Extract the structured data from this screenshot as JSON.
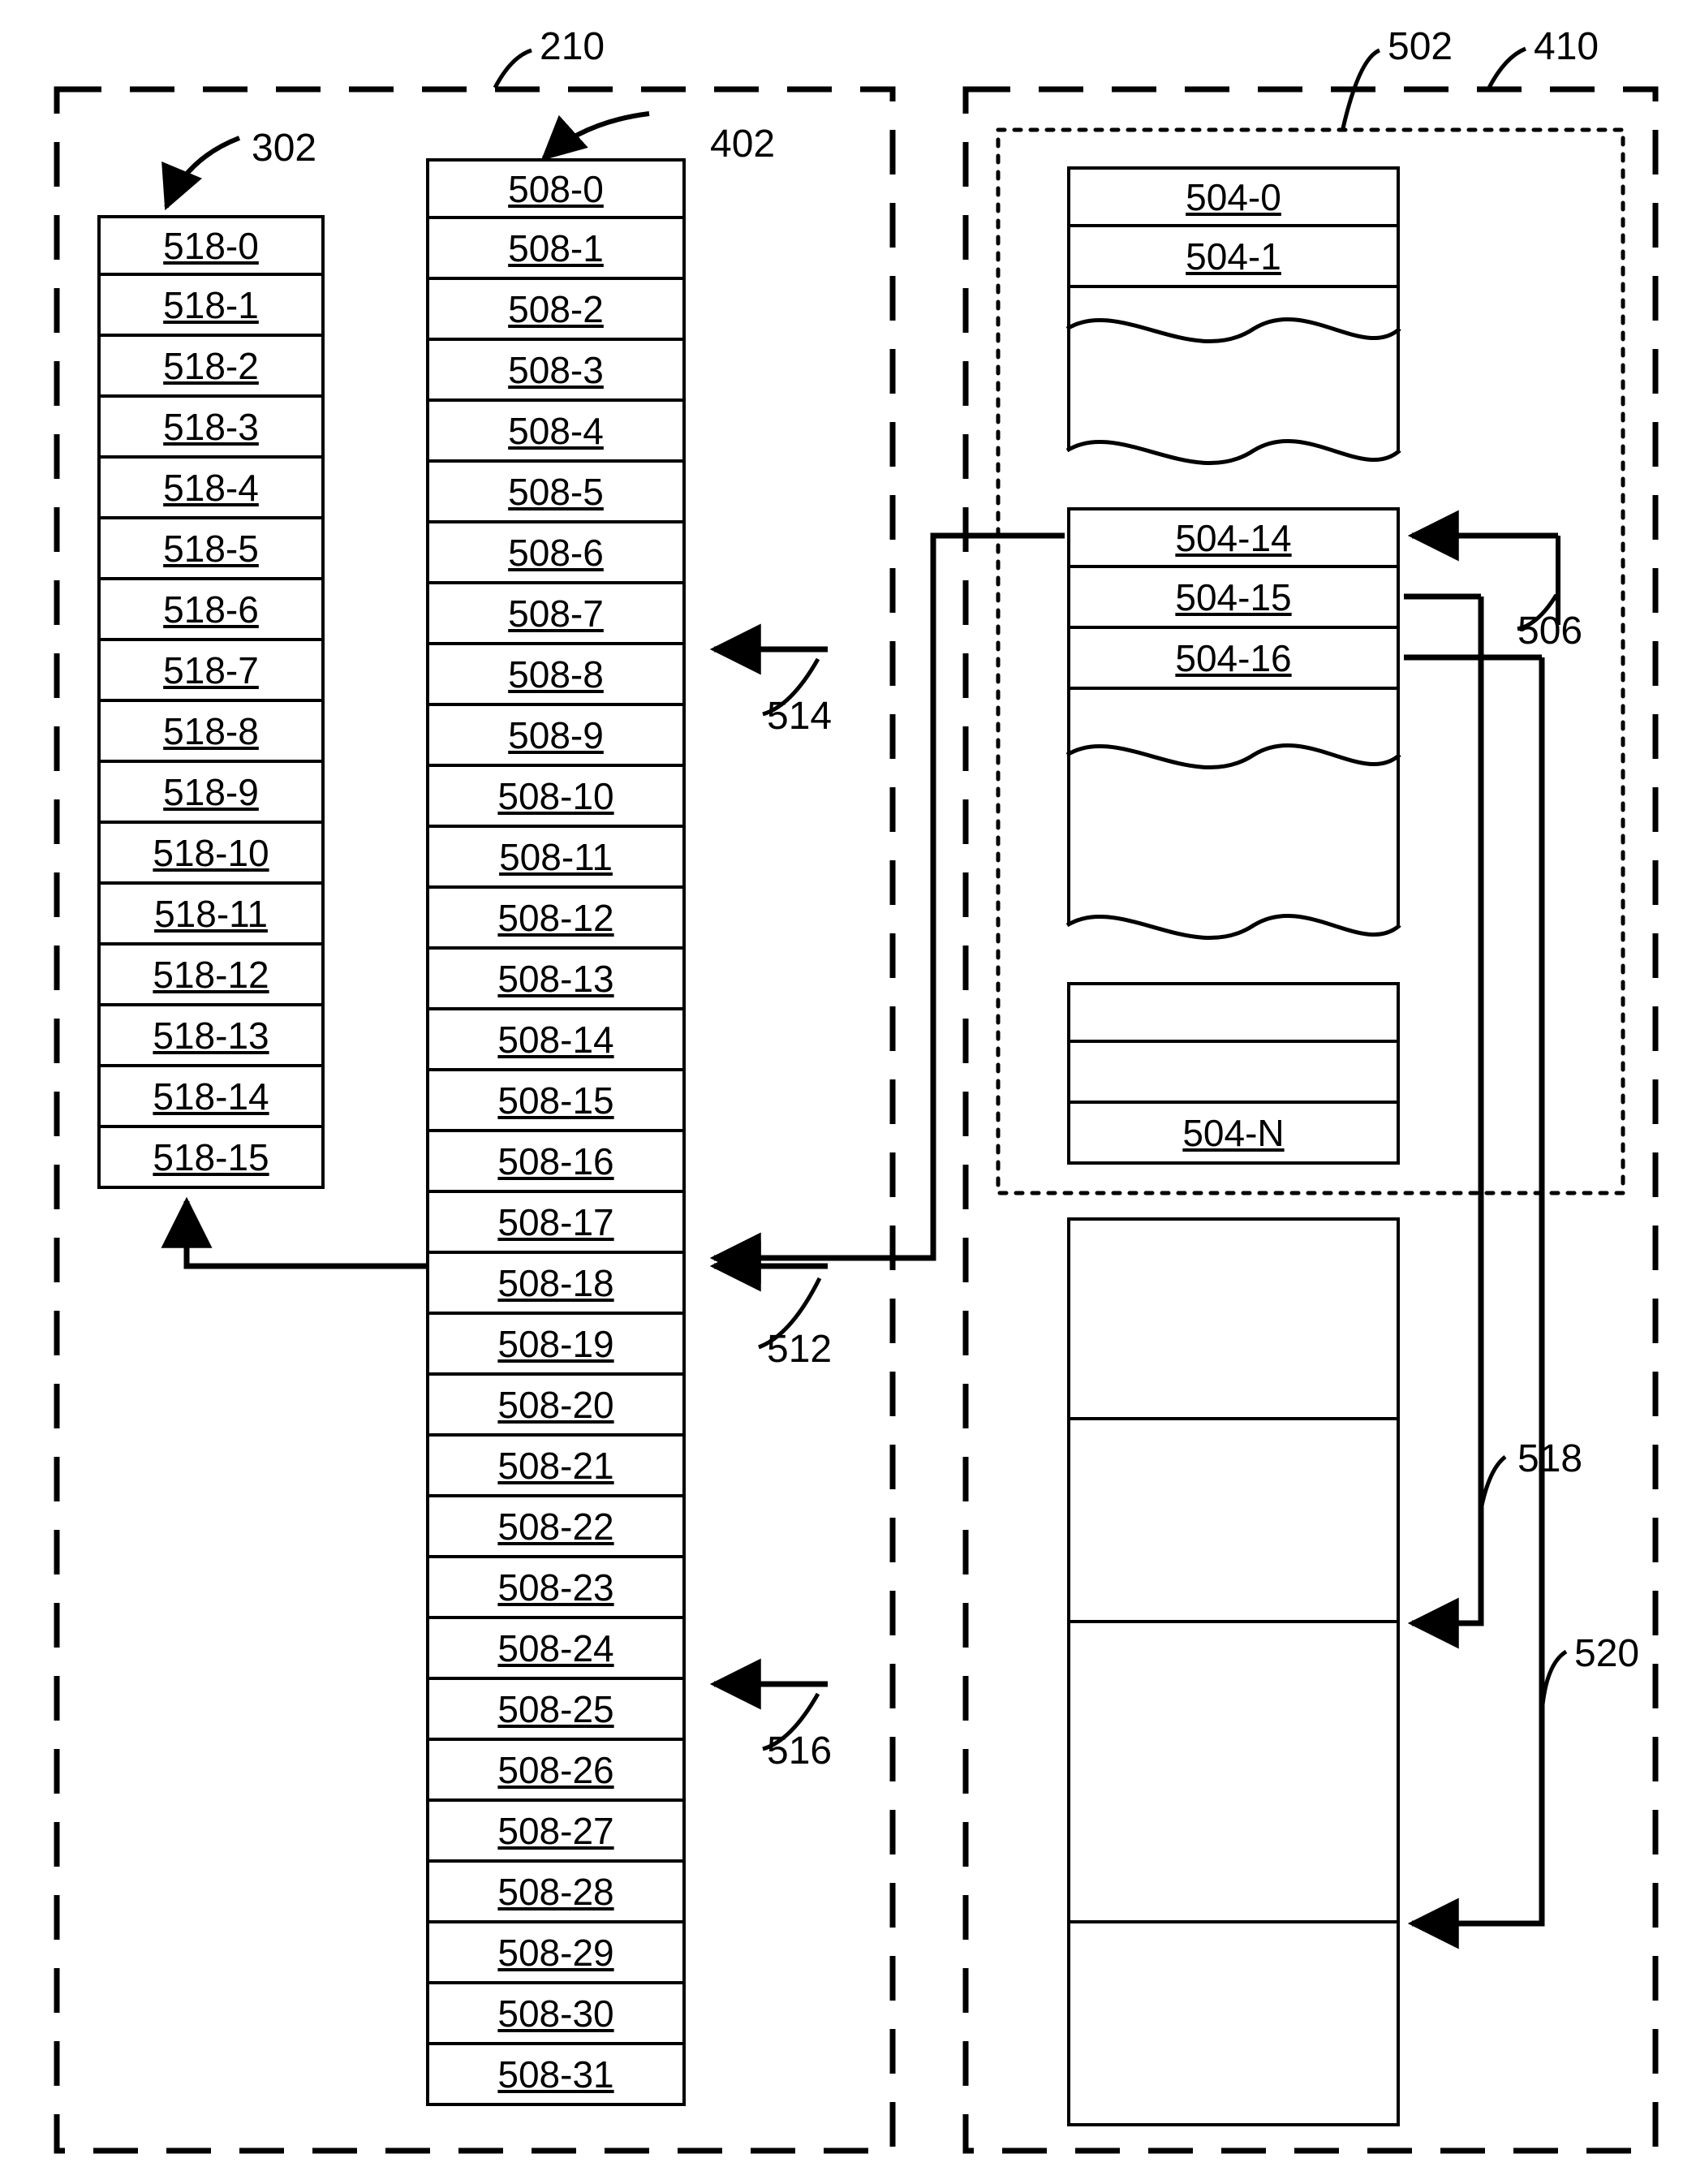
{
  "labels": {
    "l210": "210",
    "l302": "302",
    "l402": "402",
    "l410": "410",
    "l502": "502",
    "l506": "506",
    "l512": "512",
    "l514": "514",
    "l516": "516",
    "l518": "518",
    "l520": "520"
  },
  "stack518": [
    "518-0",
    "518-1",
    "518-2",
    "518-3",
    "518-4",
    "518-5",
    "518-6",
    "518-7",
    "518-8",
    "518-9",
    "518-10",
    "518-11",
    "518-12",
    "518-13",
    "518-14",
    "518-15"
  ],
  "stack508": [
    "508-0",
    "508-1",
    "508-2",
    "508-3",
    "508-4",
    "508-5",
    "508-6",
    "508-7",
    "508-8",
    "508-9",
    "508-10",
    "508-11",
    "508-12",
    "508-13",
    "508-14",
    "508-15",
    "508-16",
    "508-17",
    "508-18",
    "508-19",
    "508-20",
    "508-21",
    "508-22",
    "508-23",
    "508-24",
    "508-25",
    "508-26",
    "508-27",
    "508-28",
    "508-29",
    "508-30",
    "508-31"
  ],
  "stack504_top": [
    "504-0",
    "504-1"
  ],
  "stack504_mid": [
    "504-14",
    "504-15",
    "504-16"
  ],
  "stack504_bot_label": "504-N"
}
